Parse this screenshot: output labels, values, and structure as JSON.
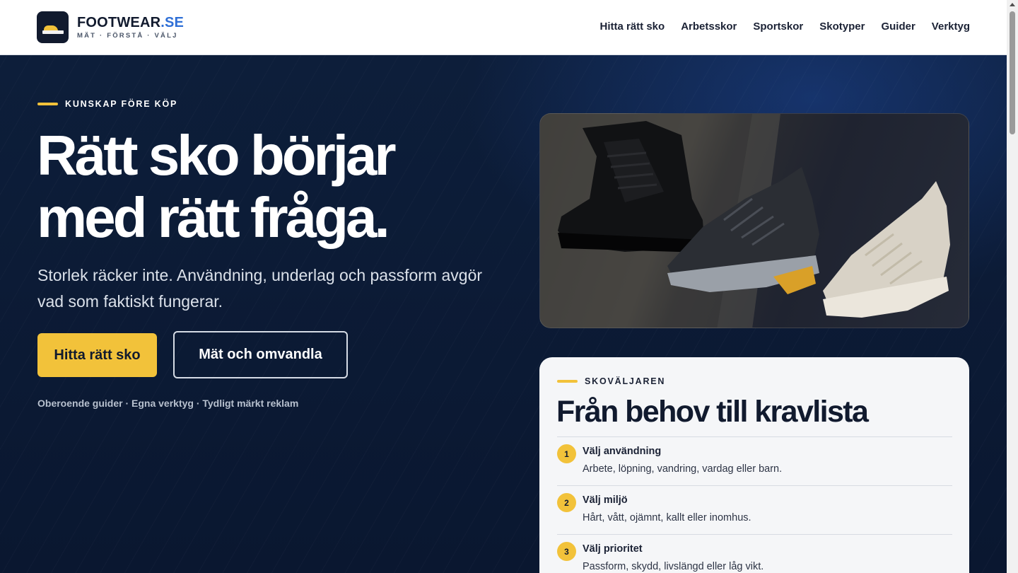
{
  "logo": {
    "name": "FOOTWEAR",
    "tld": ".SE",
    "tagline": "MÄT · FÖRSTÅ · VÄLJ"
  },
  "nav": {
    "items": [
      "Hitta rätt sko",
      "Arbetsskor",
      "Sportskor",
      "Skotyper",
      "Guider",
      "Verktyg"
    ]
  },
  "hero": {
    "eyebrow": "KUNSKAP FÖRE KÖP",
    "headline_line1": "Rätt sko börjar",
    "headline_line2": "med rätt fråga.",
    "lead": "Storlek räcker inte. Användning, underlag och passform avgör vad som faktiskt fungerar.",
    "primary_button": "Hitta rätt sko",
    "secondary_button": "Mät och omvandla",
    "trust_line": "Oberoende guider · Egna verktyg · Tydligt märkt reklam"
  },
  "card": {
    "eyebrow": "SKOVÄLJAREN",
    "title": "Från behov till kravlista",
    "steps": [
      {
        "number": "1",
        "title": "Välj användning",
        "description": "Arbete, löpning, vandring, vardag eller barn."
      },
      {
        "number": "2",
        "title": "Välj miljö",
        "description": "Hårt, vått, ojämnt, kallt eller inomhus."
      },
      {
        "number": "3",
        "title": "Välj prioritet",
        "description": "Passform, skydd, livslängd eller låg vikt."
      }
    ]
  },
  "colors": {
    "accent": "#f2c23a",
    "brand_blue": "#2f6fd6",
    "hero_bg": "#0b1a33",
    "card_bg": "#f5f6f8"
  },
  "icons": {
    "logo": "shoe-logo-icon",
    "photo": "three-shoes-photo"
  }
}
